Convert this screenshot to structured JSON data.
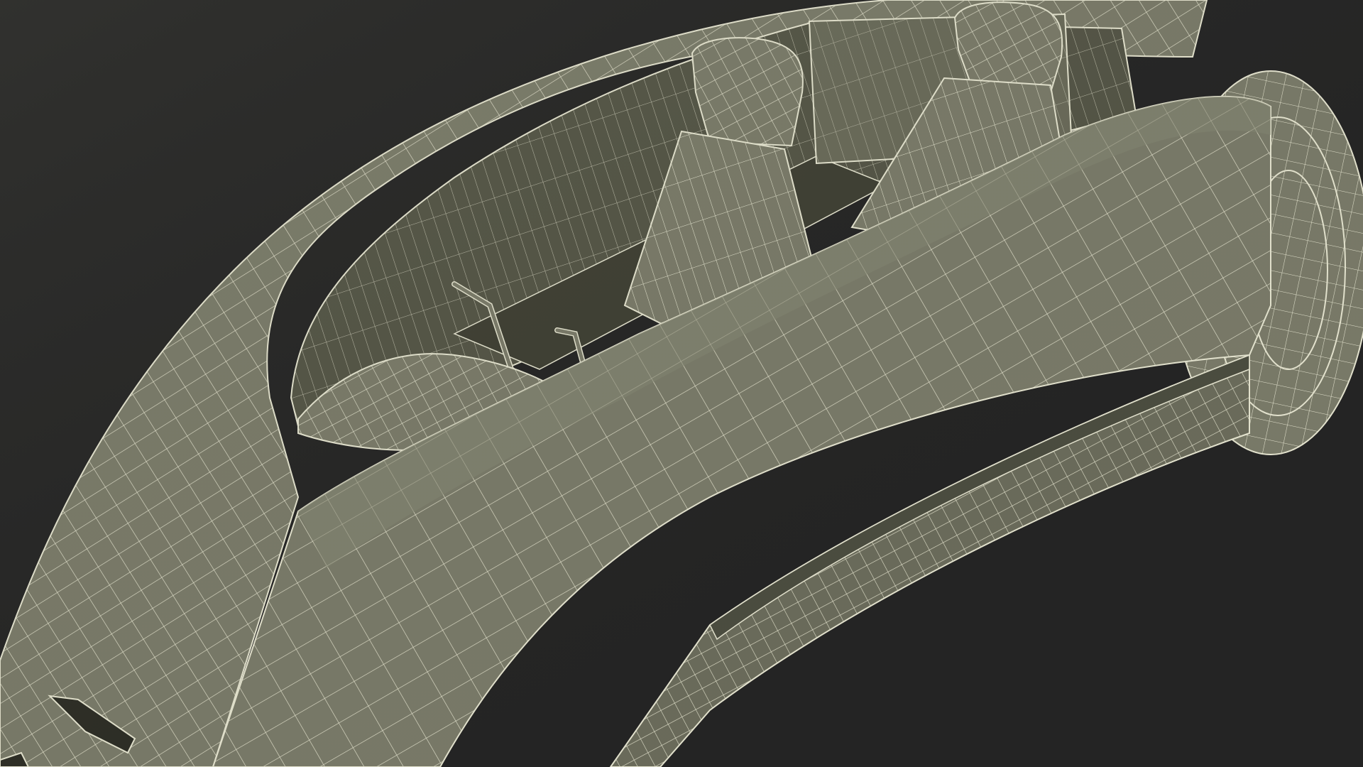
{
  "scene": {
    "subject": "car-wireframe-render",
    "colors": {
      "background": "#242424",
      "surface": "#7b7c6a",
      "surface_light": "#8b8c79",
      "surface_dark": "#5f604f",
      "interior": "#545546",
      "interior_dark": "#3e3f33",
      "wire": "#e9e8d3"
    }
  }
}
